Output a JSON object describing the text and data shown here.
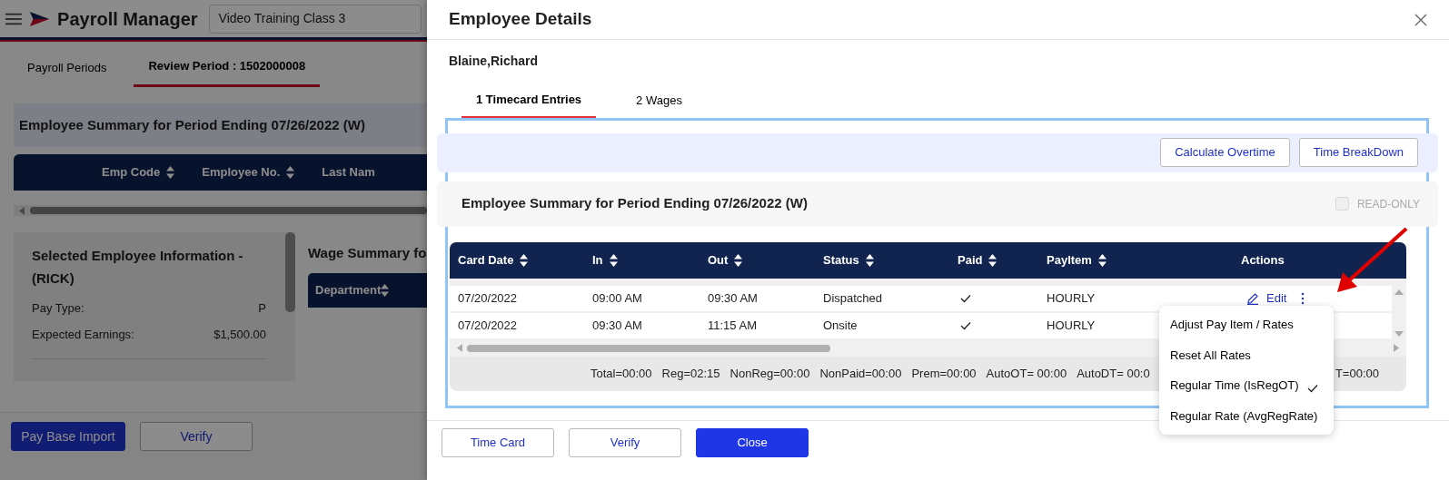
{
  "app": {
    "title": "Payroll Manager",
    "class_select": "Video Training Class 3"
  },
  "page_tabs": [
    {
      "label": "Payroll Periods",
      "selected": false
    },
    {
      "label": "Review Period : 1502000008",
      "selected": true
    }
  ],
  "summary_title": "Employee Summary for Period Ending 07/26/2022 (W)",
  "employee_table": {
    "columns": [
      {
        "label": "Emp Code",
        "sortable": true
      },
      {
        "label": "Employee No.",
        "sortable": true
      },
      {
        "label": "Last Nam",
        "sortable": false
      }
    ]
  },
  "employee_info": {
    "title": "Selected Employee Information - (RICK)",
    "fields": [
      {
        "label": "Pay Type:",
        "value": "P"
      },
      {
        "label": "Expected Earnings:",
        "value": "$1,500.00"
      }
    ]
  },
  "wage_summary": {
    "title": "Wage Summary fo",
    "columns": [
      {
        "label": "Department",
        "sortable": true
      }
    ]
  },
  "bottom_buttons": [
    {
      "label": "Pay Base Import",
      "kind": "primary"
    },
    {
      "label": "Verify",
      "kind": "outline"
    }
  ],
  "modal": {
    "title": "Employee Details",
    "employee_name": "Blaine,Richard",
    "tabs": [
      {
        "label": "1 Timecard Entries",
        "selected": true
      },
      {
        "label": "2 Wages",
        "selected": false
      }
    ],
    "toolbar_buttons": [
      "Calculate Overtime",
      "Time BreakDown"
    ],
    "summary_title": "Employee Summary for Period Ending 07/26/2022 (W)",
    "read_only": {
      "label": "READ-ONLY",
      "checked": false,
      "disabled": true
    },
    "columns": [
      {
        "label": "Card Date",
        "sortable": true
      },
      {
        "label": "In",
        "sortable": true
      },
      {
        "label": "Out",
        "sortable": true
      },
      {
        "label": "Status",
        "sortable": true
      },
      {
        "label": "Paid",
        "sortable": true
      },
      {
        "label": "PayItem",
        "sortable": true
      },
      {
        "label": "Actions",
        "sortable": false
      }
    ],
    "rows": [
      {
        "card_date": "07/20/2022",
        "in": "09:00 AM",
        "out": "09:30 AM",
        "status": "Dispatched",
        "paid": true,
        "pay_item": "HOURLY",
        "edit_label": "Edit"
      },
      {
        "card_date": "07/20/2022",
        "in": "09:30 AM",
        "out": "11:15 AM",
        "status": "Onsite",
        "paid": true,
        "pay_item": "HOURLY"
      }
    ],
    "totals": [
      "Total=00:00",
      "Reg=02:15",
      "NonReg=00:00",
      "NonPaid=00:00",
      "Prem=00:00",
      "AutoOT= 00:00",
      "AutoDT= 00:0"
    ],
    "totals_tail": "T=00:00",
    "context_menu": [
      {
        "label": "Adjust Pay Item / Rates",
        "checked": false
      },
      {
        "label": "Reset All Rates",
        "checked": false
      },
      {
        "label": "Regular Time (IsRegOT)",
        "checked": true
      },
      {
        "label": "Regular Rate (AvgRegRate)",
        "checked": false
      }
    ],
    "footer_buttons": [
      {
        "label": "Time Card",
        "kind": "outline"
      },
      {
        "label": "Verify",
        "kind": "outline"
      },
      {
        "label": "Close",
        "kind": "primary"
      }
    ]
  }
}
